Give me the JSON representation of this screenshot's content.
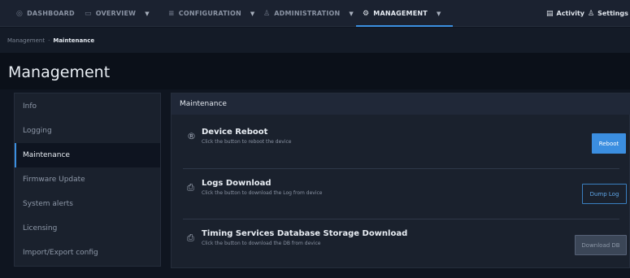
{
  "topnav": {
    "items": [
      {
        "label": "DASHBOARD",
        "icon": "dashboard-icon",
        "glyph": "◎",
        "caret": false,
        "active": false
      },
      {
        "label": "OVERVIEW",
        "icon": "monitor-icon",
        "glyph": "▭",
        "caret": true,
        "active": false
      },
      {
        "label": "CONFIGURATION",
        "icon": "sliders-icon",
        "glyph": "≡",
        "caret": true,
        "active": false
      },
      {
        "label": "ADMINISTRATION",
        "icon": "users-icon",
        "glyph": "♙",
        "caret": true,
        "active": false
      },
      {
        "label": "MANAGEMENT",
        "icon": "gear-icon",
        "glyph": "⚙",
        "caret": true,
        "active": true
      }
    ],
    "activity_label": "Activity",
    "settings_label": "Settings"
  },
  "breadcrumb": {
    "parent": "Management",
    "separator": "·",
    "current": "Maintenance"
  },
  "page": {
    "title": "Management"
  },
  "sidebar": {
    "items": [
      {
        "label": "Info",
        "active": false
      },
      {
        "label": "Logging",
        "active": false
      },
      {
        "label": "Maintenance",
        "active": true
      },
      {
        "label": "Firmware Update",
        "active": false
      },
      {
        "label": "System alerts",
        "active": false
      },
      {
        "label": "Licensing",
        "active": false
      },
      {
        "label": "Import/Export config",
        "active": false
      }
    ]
  },
  "panel": {
    "header": "Maintenance",
    "rows": [
      {
        "title": "Device Reboot",
        "description": "Click the button to reboot the device",
        "icon": "reboot-icon",
        "button_label": "Reboot",
        "button_style": "primary"
      },
      {
        "title": "Logs Download",
        "description": "Click the button to download the Log from device",
        "icon": "file-download-icon",
        "button_label": "Dump Log",
        "button_style": "outline"
      },
      {
        "title": "Timing Services Database Storage Download",
        "description": "Click the button to download the DB from device",
        "icon": "file-download-icon",
        "button_label": "Download DB",
        "button_style": "disabled"
      }
    ]
  },
  "colors": {
    "accent": "#3b8fe0",
    "background": "#0f1520",
    "panel": "#1a212d"
  }
}
